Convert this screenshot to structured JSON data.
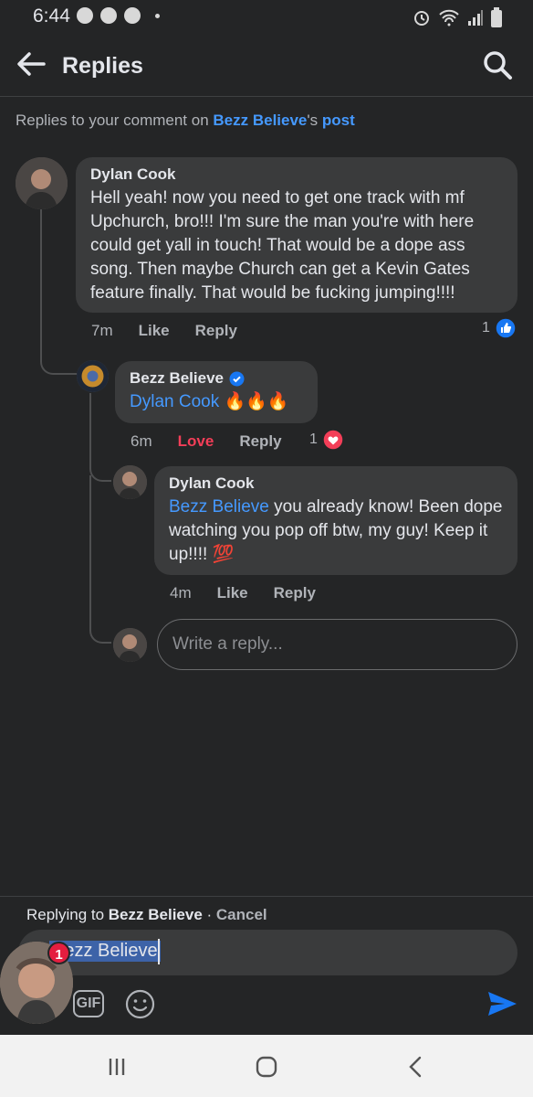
{
  "status_bar": {
    "time": "6:44",
    "left_icons": [
      "messenger-icon",
      "chrome-icon",
      "messenger-icon",
      "dot"
    ],
    "right_icons": [
      "alarm-icon",
      "wifi-icon",
      "signal-icon",
      "battery-icon"
    ]
  },
  "header": {
    "title": "Replies",
    "back_icon": "arrow-left-icon",
    "search_icon": "search-icon"
  },
  "context": {
    "prefix": "Replies to your comment on ",
    "page_name": "Bezz Believe",
    "possessive": "'s ",
    "post_link": "post"
  },
  "comments": [
    {
      "author": "Dylan Cook",
      "text": "Hell yeah! now you need to get one track with mf Upchurch, bro!!! I'm sure the man you're with here could get yall in touch! That would be a dope ass song. Then maybe Church can get a Kevin Gates feature finally. That would be fucking jumping!!!!",
      "time": "7m",
      "like_label": "Like",
      "reply_label": "Reply",
      "reaction_count": "1",
      "reaction_type": "like"
    },
    {
      "author": "Bezz Believe",
      "verified": true,
      "mention": "Dylan Cook",
      "text": " 🔥🔥🔥",
      "time": "6m",
      "like_label": "Love",
      "reply_label": "Reply",
      "reaction_count": "1",
      "reaction_type": "love"
    },
    {
      "author": "Dylan Cook",
      "mention": "Bezz Believe",
      "text": " you already know! Been dope watching you pop off btw, my guy! Keep it up!!!! 💯",
      "time": "4m",
      "like_label": "Like",
      "reply_label": "Reply"
    }
  ],
  "reply_box": {
    "placeholder": "Write a reply..."
  },
  "composer": {
    "replying_prefix": "Replying to ",
    "replying_name": "Bezz Believe",
    "separator": " · ",
    "cancel_label": "Cancel",
    "draft_text": "Bezz Believe",
    "gif_label": "GIF",
    "emoji_icon": "smiley-icon",
    "send_icon": "send-icon",
    "chat_head_badge": "1"
  },
  "nav_bar": {
    "items": [
      "recents-icon",
      "home-icon",
      "back-icon"
    ]
  },
  "colors": {
    "background": "#242526",
    "bubble": "#3a3b3c",
    "link": "#4599ff",
    "love": "#f33e58"
  }
}
